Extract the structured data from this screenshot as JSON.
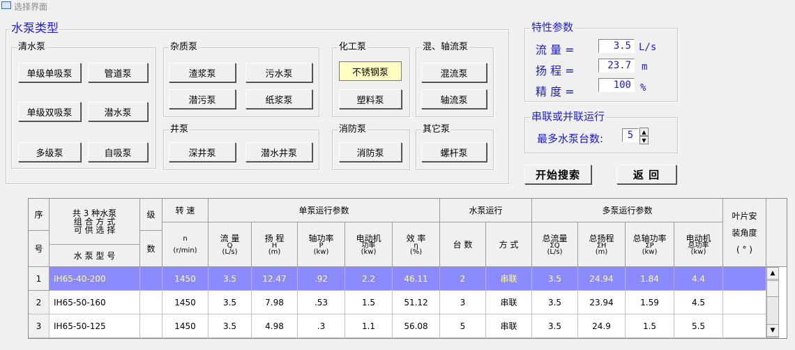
{
  "window": {
    "title": "选择界面"
  },
  "pump_types": {
    "legend": "水泵类型",
    "groups": {
      "clear_water": {
        "legend": "清水泵",
        "buttons": [
          "单级单吸泵",
          "管道泵",
          "单级双吸泵",
          "潜水泵",
          "多级泵",
          "自吸泵"
        ]
      },
      "impurity": {
        "legend": "杂质泵",
        "buttons": [
          "渣浆泵",
          "污水泵",
          "潜污泵",
          "纸浆泵"
        ]
      },
      "well": {
        "legend": "井泵",
        "buttons": [
          "深井泵",
          "潜水井泵"
        ]
      },
      "chemical": {
        "legend": "化工泵",
        "buttons": [
          "不锈钢泵",
          "塑料泵"
        ],
        "selected": "不锈钢泵"
      },
      "mixed_axial": {
        "legend": "混、轴流泵",
        "buttons": [
          "混流泵",
          "轴流泵"
        ]
      },
      "fire": {
        "legend": "消防泵",
        "buttons": [
          "消防泵"
        ]
      },
      "other": {
        "legend": "其它泵",
        "buttons": [
          "螺杆泵"
        ]
      }
    }
  },
  "params": {
    "legend": "特性参数",
    "flow": {
      "label": "流  量 =",
      "value": "3.5",
      "unit": "L/s"
    },
    "head": {
      "label": "扬  程 =",
      "value": "23.7",
      "unit": "m"
    },
    "precision": {
      "label": "精  度 =",
      "value": "100",
      "unit": "%"
    }
  },
  "series": {
    "legend": "串联或并联运行",
    "max_label": "最多水泵台数:",
    "max_value": "5"
  },
  "actions": {
    "search": "开始搜索",
    "back": "返  回"
  },
  "table": {
    "headers": {
      "seq": [
        "序",
        "号"
      ],
      "combo": [
        "共 3 种水泵",
        "组 合 方 式",
        "可 供 选 择"
      ],
      "model": "水 泵 型 号",
      "stage": [
        "级",
        "数"
      ],
      "speed": [
        "转  速",
        "n",
        "(r/min)"
      ],
      "single": "单泵运行参数",
      "flow": [
        "流  量",
        "Q",
        "(L/s)"
      ],
      "head": [
        "扬  程",
        "H",
        "(m)"
      ],
      "shaft": [
        "轴功率",
        "P",
        "(kw)"
      ],
      "motor": [
        "电动机",
        "功率",
        "(kw)"
      ],
      "eff": [
        "效  率",
        "η",
        "(%)"
      ],
      "run": "水泵运行",
      "count": "台  数",
      "mode": "方  式",
      "multi": "多泵运行参数",
      "tflow": [
        "总流量",
        "ΣQ",
        "(L/s)"
      ],
      "thead": [
        "总扬程",
        "ΣH",
        "(m)"
      ],
      "tshaft": [
        "总轴功率",
        "ΣP",
        "(kw)"
      ],
      "tmotor": [
        "电动机",
        "总功率",
        "(kw)"
      ],
      "blade": [
        "叶片安",
        "装角度",
        "( ° )"
      ]
    },
    "rows": [
      {
        "no": "1",
        "model": "IH65-40-200",
        "speed": "1450",
        "q": "3.5",
        "h": "12.47",
        "p": ".92",
        "motor": "2.2",
        "eff": "46.11",
        "count": "2",
        "mode": "串联",
        "tq": "3.5",
        "th": "24.94",
        "tp": "1.84",
        "tm": "4.4",
        "selected": true
      },
      {
        "no": "2",
        "model": "IH65-50-160",
        "speed": "1450",
        "q": "3.5",
        "h": "7.98",
        "p": ".53",
        "motor": "1.5",
        "eff": "51.12",
        "count": "3",
        "mode": "串联",
        "tq": "3.5",
        "th": "23.94",
        "tp": "1.59",
        "tm": "4.5"
      },
      {
        "no": "3",
        "model": "IH65-50-125",
        "speed": "1450",
        "q": "3.5",
        "h": "4.98",
        "p": ".3",
        "motor": "1.1",
        "eff": "56.08",
        "count": "5",
        "mode": "串联",
        "tq": "3.5",
        "th": "24.9",
        "tp": "1.5",
        "tm": "5.5"
      }
    ]
  }
}
